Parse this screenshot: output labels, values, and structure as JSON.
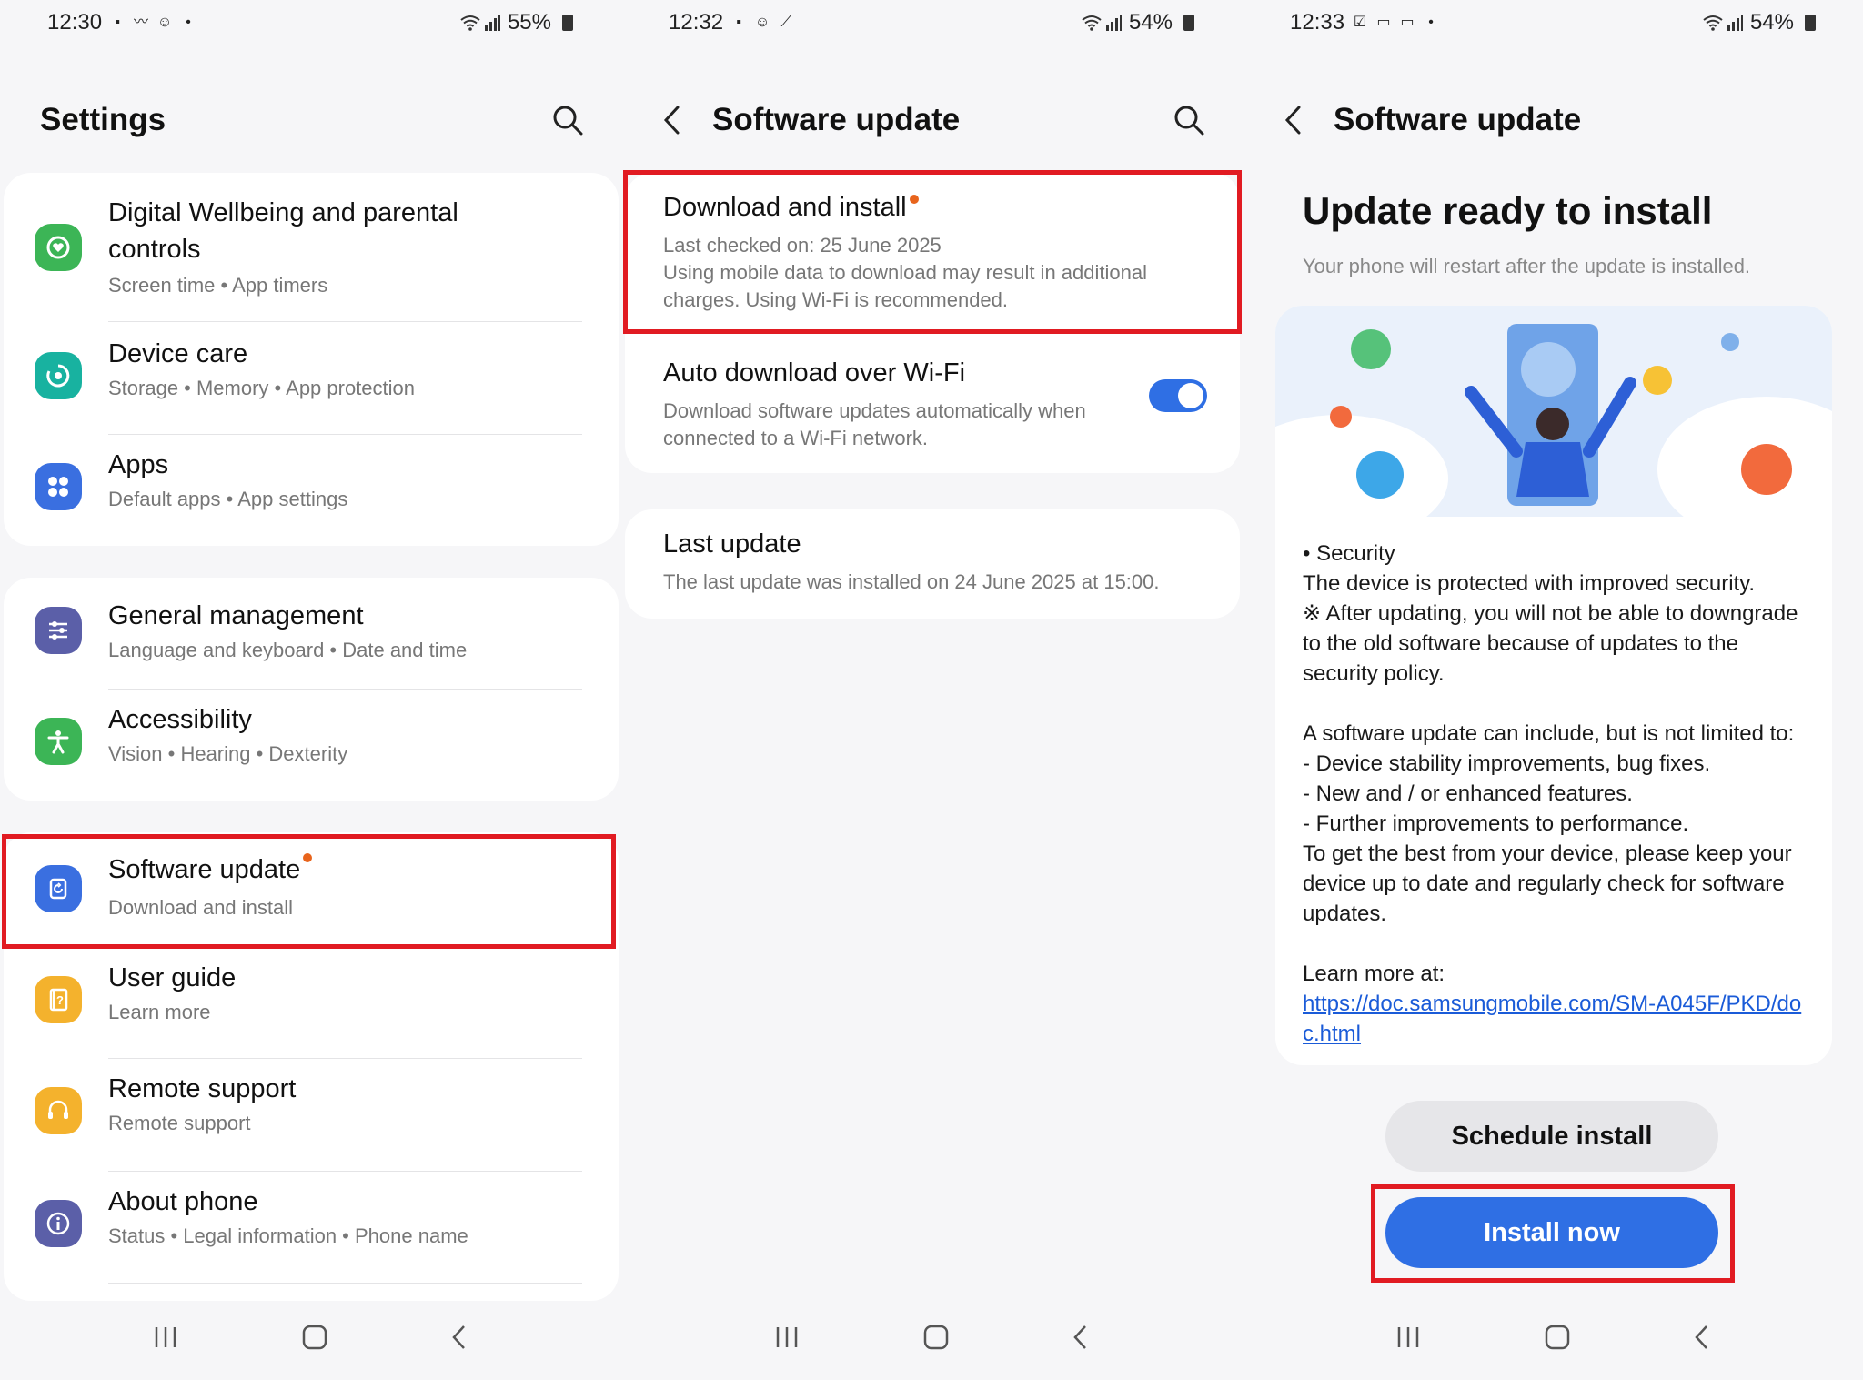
{
  "screens": [
    {
      "status": {
        "time": "12:30",
        "battery": "55%"
      },
      "header": {
        "title": "Settings"
      },
      "items": [
        {
          "title": "Digital Wellbeing and parental controls",
          "title_line1": "Digital Wellbeing and parental",
          "title_line2": "controls",
          "subtitle": "Screen time  •  App timers",
          "icon": "heart-circle-icon",
          "color": "#3cb556"
        },
        {
          "title": "Device care",
          "subtitle": "Storage  •  Memory  •  App protection",
          "icon": "device-care-icon",
          "color": "#18b2a0"
        },
        {
          "title": "Apps",
          "subtitle": "Default apps  •  App settings",
          "icon": "apps-grid-icon",
          "color": "#3a6fe0"
        },
        {
          "title": "General management",
          "subtitle": "Language and keyboard  •  Date and time",
          "icon": "sliders-icon",
          "color": "#5b5fa8"
        },
        {
          "title": "Accessibility",
          "subtitle": "Vision  •  Hearing  •  Dexterity",
          "icon": "accessibility-icon",
          "color": "#3cb556"
        },
        {
          "title": "Software update",
          "subtitle": "Download and install",
          "icon": "software-update-icon",
          "color": "#3a6fe0"
        },
        {
          "title": "User guide",
          "subtitle": "Learn more",
          "icon": "user-guide-icon",
          "color": "#f4b22d"
        },
        {
          "title": "Remote support",
          "subtitle": "Remote support",
          "icon": "headset-icon",
          "color": "#f4b22d"
        },
        {
          "title": "About phone",
          "subtitle": "Status  •  Legal information  •  Phone name",
          "icon": "info-icon",
          "color": "#5b5fa8"
        }
      ]
    },
    {
      "status": {
        "time": "12:32",
        "battery": "54%"
      },
      "header": {
        "title": "Software update"
      },
      "download": {
        "title": "Download and install",
        "checked": "Last checked on: 25 June 2025",
        "note_line1": "Using mobile data to download may result in additional",
        "note_line2": "charges. Using Wi-Fi is recommended."
      },
      "auto": {
        "title": "Auto download over Wi-Fi",
        "desc_line1": "Download software updates automatically when",
        "desc_line2": "connected to a Wi-Fi network.",
        "enabled": true
      },
      "last": {
        "title": "Last update",
        "desc": "The last update was installed on 24 June 2025 at 15:00."
      }
    },
    {
      "status": {
        "time": "12:33",
        "battery": "54%"
      },
      "header": {
        "title": "Software update"
      },
      "heading": "Update ready to install",
      "subheading": "Your phone will restart after the update is installed.",
      "body": {
        "bullet": "• Security",
        "sec1": "The device is protected with improved security.",
        "sec2": "※ After updating, you will not be able to downgrade to the old software because of updates to the security policy.",
        "inc": "A software update can include, but is not limited to:",
        "l1": " - Device stability improvements, bug fixes.",
        "l2": " - New and / or enhanced features.",
        "l3": " - Further improvements to performance.",
        "best": "To get the best from your device, please keep your device up to date and regularly check for software updates.",
        "learn": "Learn more at:",
        "url": "https://doc.samsungmobile.com/SM-A045F/PKD/doc.html"
      },
      "schedule_label": "Schedule install",
      "install_label": "Install now"
    }
  ],
  "colors": {
    "accent": "#2f6fe4",
    "highlight": "#e11b22",
    "badge": "#e8641c"
  }
}
